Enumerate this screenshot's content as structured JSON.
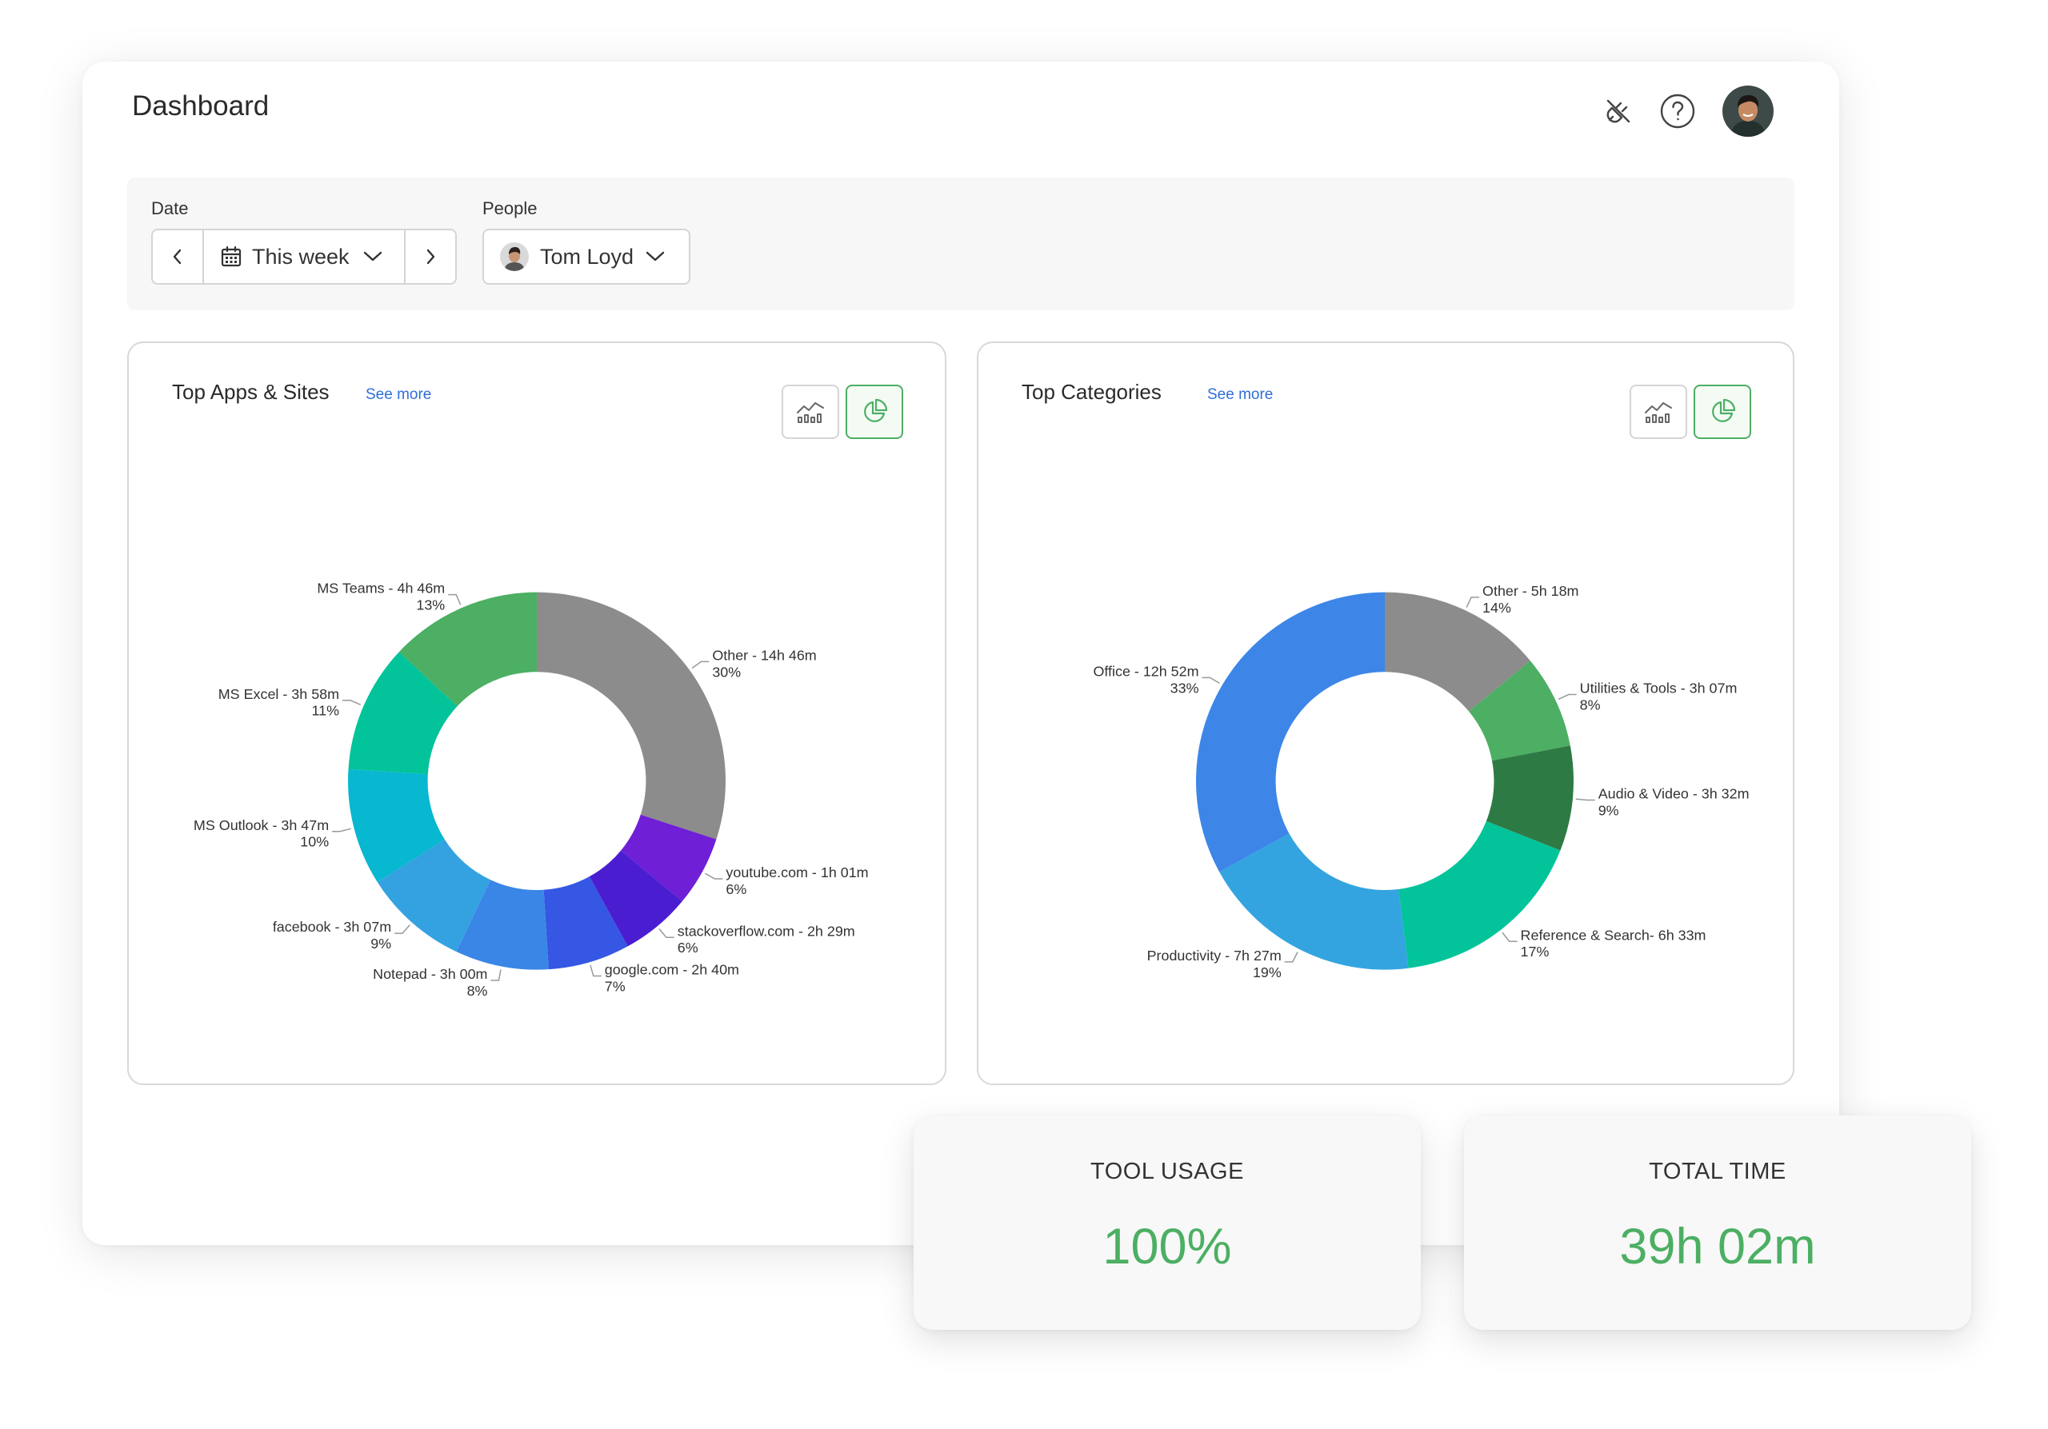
{
  "header": {
    "title": "Dashboard",
    "icons": [
      "plug-icon",
      "help-icon",
      "user-avatar"
    ]
  },
  "filters": {
    "date_label": "Date",
    "date_value": "This week",
    "people_label": "People",
    "people_value": "Tom Loyd"
  },
  "panels": [
    {
      "title": "Top Apps & Sites",
      "see_more": "See more",
      "view_modes": [
        "line-chart-icon",
        "pie-chart-icon"
      ],
      "active_view": "pie-chart-icon"
    },
    {
      "title": "Top Categories",
      "see_more": "See more",
      "view_modes": [
        "line-chart-icon",
        "pie-chart-icon"
      ],
      "active_view": "pie-chart-icon"
    }
  ],
  "stats": [
    {
      "label": "TOOL USAGE",
      "value": "100%"
    },
    {
      "label": "TOTAL TIME",
      "value": "39h 02m"
    }
  ],
  "colors": {
    "accent_green": "#4caf63",
    "link_blue": "#2f6fd6"
  },
  "chart_data": [
    {
      "type": "pie",
      "donut": true,
      "title": "Top Apps & Sites",
      "slices": [
        {
          "name": "Other",
          "time": "14h 46m",
          "percent": "30%",
          "value": 30,
          "color": "#8c8c8c"
        },
        {
          "name": "youtube.com",
          "time": "1h 01m",
          "percent": "6%",
          "value": 6,
          "color": "#6f1fd6"
        },
        {
          "name": "stackoverflow.com",
          "time": "2h 29m",
          "percent": "6%",
          "value": 6,
          "color": "#4a1ed0"
        },
        {
          "name": "google.com",
          "time": "2h 40m",
          "percent": "7%",
          "value": 7,
          "color": "#3557e3"
        },
        {
          "name": "Notepad",
          "time": "3h 00m",
          "percent": "8%",
          "value": 8,
          "color": "#3a86e6"
        },
        {
          "name": "facebook",
          "time": "3h 07m",
          "percent": "9%",
          "value": 9,
          "color": "#34a2e0"
        },
        {
          "name": "MS Outlook",
          "time": "3h 47m",
          "percent": "10%",
          "value": 10,
          "color": "#08b7d0"
        },
        {
          "name": "MS Excel",
          "time": "3h 58m",
          "percent": "11%",
          "value": 11,
          "color": "#03c39a"
        },
        {
          "name": "MS Teams",
          "time": "4h 46m",
          "percent": "13%",
          "value": 13,
          "color": "#4caf63"
        }
      ]
    },
    {
      "type": "pie",
      "donut": true,
      "title": "Top Categories",
      "slices": [
        {
          "name": "Other",
          "time": "5h 18m",
          "percent": "14%",
          "value": 14,
          "color": "#8c8c8c"
        },
        {
          "name": "Utilities & Tools",
          "time": "3h 07m",
          "percent": "8%",
          "value": 8,
          "color": "#4caf63"
        },
        {
          "name": "Audio & Video",
          "time": "3h 32m",
          "percent": "9%",
          "value": 9,
          "color": "#2e7a44"
        },
        {
          "name": "Reference & Search",
          "time": "6h 33m",
          "percent": "17%",
          "value": 17,
          "color": "#03c39a"
        },
        {
          "name": "Productivity",
          "time": "7h 27m",
          "percent": "19%",
          "value": 19,
          "color": "#33a4e0"
        },
        {
          "name": "Office",
          "time": "12h 52m",
          "percent": "33%",
          "value": 33,
          "color": "#3d86e8"
        }
      ]
    }
  ]
}
